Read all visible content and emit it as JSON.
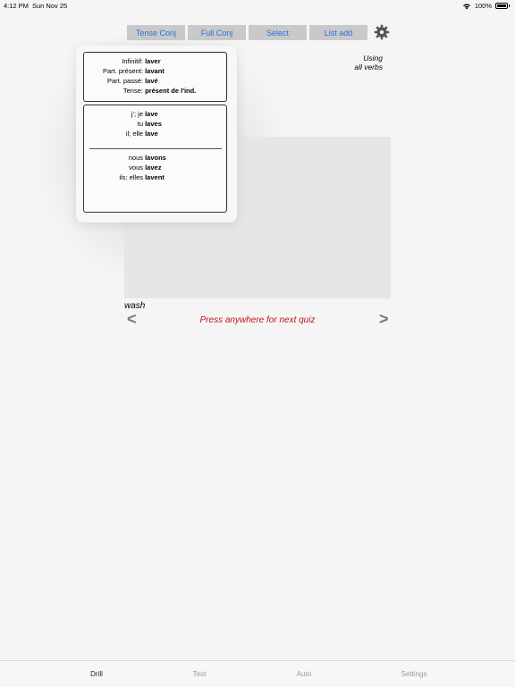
{
  "status": {
    "time": "4:12 PM",
    "date": "Sun Nov 25",
    "battery": "100%"
  },
  "toolbar": {
    "buttons": [
      "Tense Conj",
      "Full Conj",
      "Select",
      "List add"
    ]
  },
  "using": {
    "line1": "Using",
    "line2": "all verbs"
  },
  "popover": {
    "info": [
      {
        "key": "Infinitif:",
        "value": "laver"
      },
      {
        "key": "Part. présent:",
        "value": "lavant"
      },
      {
        "key": "Part. passé:",
        "value": "lavé"
      },
      {
        "key": "Tense:",
        "value": "présent de l'ind."
      }
    ],
    "singular": [
      {
        "pronoun": "j'; je",
        "form": "lave"
      },
      {
        "pronoun": "tu",
        "form": "laves"
      },
      {
        "pronoun": "il; elle",
        "form": "lave"
      }
    ],
    "plural": [
      {
        "pronoun": "nous",
        "form": "lavons"
      },
      {
        "pronoun": "vous",
        "form": "lavez"
      },
      {
        "pronoun": "ils; elles",
        "form": "lavent"
      }
    ]
  },
  "quiz": {
    "meaning": "wash",
    "prev": "<",
    "next": ">",
    "hint": "Press anywhere for next quiz"
  },
  "tabs": [
    "Drill",
    "Test",
    "Auto",
    "Settings"
  ],
  "colors": {
    "accent": "#2a6edb",
    "hint": "#c0141e"
  },
  "icons": {
    "settings": "gear-icon",
    "wifi": "wifi-icon",
    "battery": "battery-icon"
  }
}
